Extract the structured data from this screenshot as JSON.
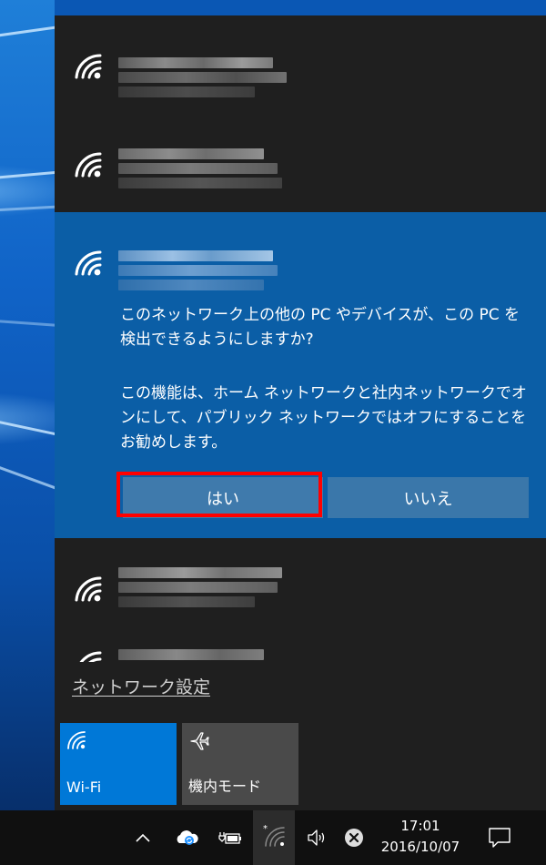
{
  "networks": {
    "prompt_question": "このネットワーク上の他の PC やデバイスが、この PC を検出できるようにしますか?",
    "prompt_explanation": "この機能は、ホーム ネットワークと社内ネットワークでオンにして、パブリック ネットワークではオフにすることをお勧めします。",
    "yes_label": "はい",
    "no_label": "いいえ"
  },
  "settings_link": "ネットワーク設定",
  "quick_actions": {
    "wifi_label": "Wi-Fi",
    "airplane_label": "機内モード"
  },
  "taskbar": {
    "time": "17:01",
    "date": "2016/10/07",
    "icons": [
      "chevron-up-icon",
      "onedrive-sync-icon",
      "battery-plug-icon",
      "wifi-icon",
      "volume-icon",
      "close-circle-icon",
      "action-center-icon"
    ]
  },
  "colors": {
    "flyout_bg": "#1f1f1f",
    "selected_bg": "#0b5ea6",
    "accent": "#0078d7",
    "highlight": "#ff0000"
  }
}
